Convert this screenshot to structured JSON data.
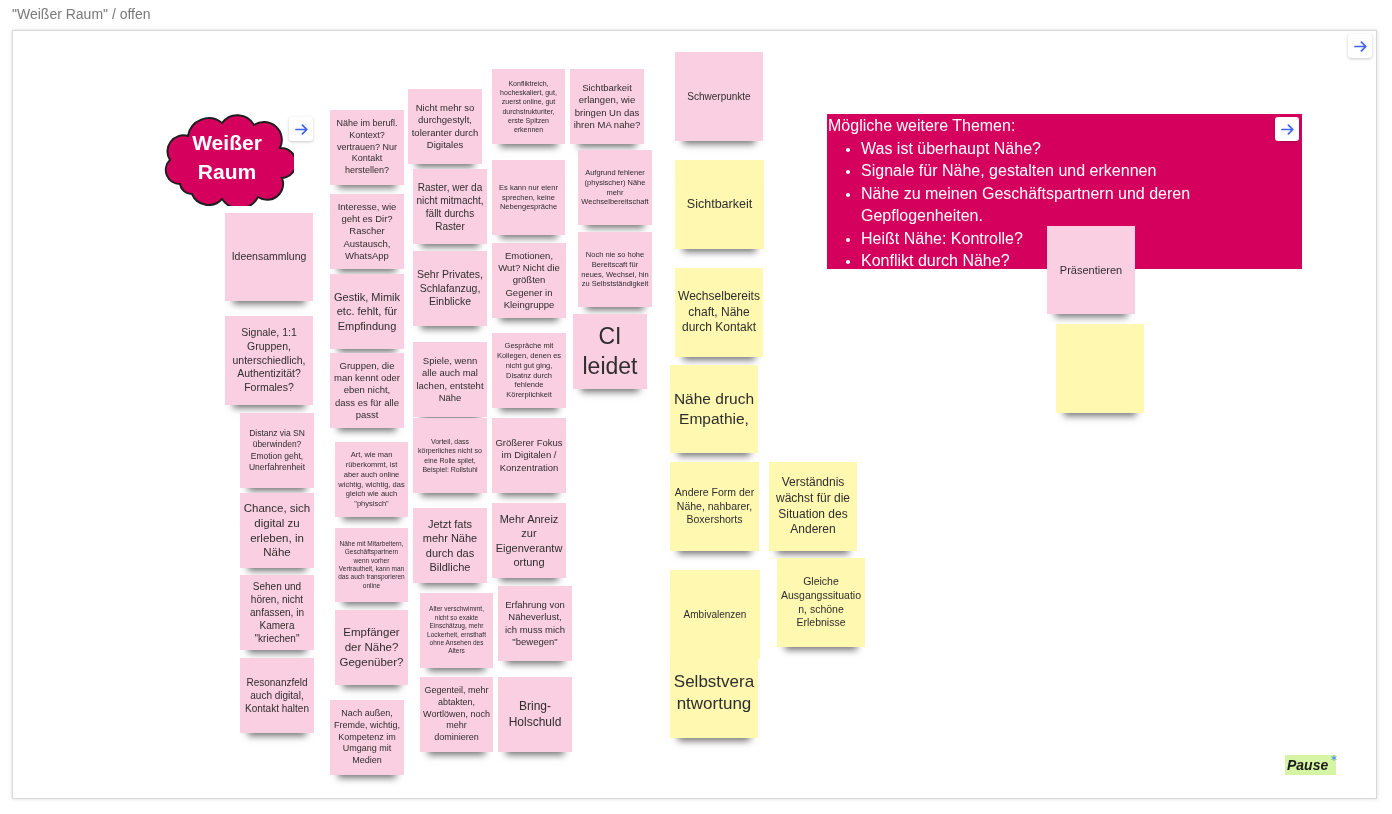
{
  "board": {
    "title": "\"Weißer Raum\" / offen"
  },
  "cloud": {
    "text": "Weißer Raum"
  },
  "notes": [
    {
      "text": "Ideensammlung",
      "color": "#fbcfe2"
    },
    {
      "text": "Signale, 1:1 Gruppen, unterschiedlich, Authentizität? Formales?",
      "color": "#fbcfe2"
    },
    {
      "text": "Distanz via SN überwinden? Emotion geht, Unerfahrenheit",
      "color": "#fbcfe2"
    },
    {
      "text": "Chance, sich digital zu erleben, in Nähe",
      "color": "#fbcfe2"
    },
    {
      "text": "Sehen und hören, nicht anfassen, in Kamera \"kriechen\"",
      "color": "#fbcfe2"
    },
    {
      "text": "Resonanzfeld auch digital, Kontakt halten",
      "color": "#fbcfe2"
    },
    {
      "text": "Nähe im berufl. Kontext? vertrauen? Nur Kontakt herstellen?",
      "color": "#fbcfe2"
    },
    {
      "text": "Interesse, wie geht es Dir? Rascher Austausch, WhatsApp",
      "color": "#fbcfe2"
    },
    {
      "text": "Gestik, Mimik etc. fehlt, für Empfindung",
      "color": "#fbcfe2"
    },
    {
      "text": "Gruppen, die man kennt oder eben nicht, dass es für alle passt",
      "color": "#fbcfe2"
    },
    {
      "text": "Art, wie man rüberkommt, ist aber auch online wichtig, wichtig, das gleich wie auch \"physisch\"",
      "color": "#fbcfe2"
    },
    {
      "text": "Nähe mit Mitarbeitern, Geschäftspartnern wenn vorher Vertrautheit, kann man das auch transporieren online",
      "color": "#fbcfe2"
    },
    {
      "text": "Empfänger der Nähe? Gegenüber?",
      "color": "#fbcfe2"
    },
    {
      "text": "Nach außen, Fremde, wichtig, Kompetenz im Umgang mit Medien",
      "color": "#fbcfe2"
    },
    {
      "text": "Nicht mehr so durchgestylt, toleranter durch Digitales",
      "color": "#fbcfe2"
    },
    {
      "text": "Raster, wer da nicht mitmacht, fällt durchs Raster",
      "color": "#fbcfe2"
    },
    {
      "text": "Sehr Privates, Schlafanzug, Einblicke",
      "color": "#fbcfe2"
    },
    {
      "text": "Spiele, wenn alle auch mal lachen, entsteht Nähe",
      "color": "#fbcfe2"
    },
    {
      "text": "Vorteil, dass körperliches nicht so eine Rolle spilet, Beispiel: Rollstuhl",
      "color": "#fbcfe2"
    },
    {
      "text": "Jetzt fats mehr Nähe durch das Bildliche",
      "color": "#fbcfe2"
    },
    {
      "text": "Alter verschwimmt, nicht so exakte Einschätzug, mehr Lockerheit, ernsthaft ohne Ansehen des Alters",
      "color": "#fbcfe2"
    },
    {
      "text": "Gegenteil, mehr abtakten, Wortlöwen, noch mehr dominieren",
      "color": "#fbcfe2"
    },
    {
      "text": "Konfliktreich, hocheskaliert, gut, zuerst online, gut durchstrukturiter, erste Spitzen erkennen",
      "color": "#fbcfe2"
    },
    {
      "text": "Es kann nur eienr sprechen, keine Nebengespräche",
      "color": "#fbcfe2"
    },
    {
      "text": "Emotionen, Wut? Nicht die größten Gegener in Kleingruppe",
      "color": "#fbcfe2"
    },
    {
      "text": "Gespräche mit Kollegen, denen es nicht gut ging, Disatnz durch fehlende Körerplichkeit",
      "color": "#fbcfe2"
    },
    {
      "text": "Größerer Fokus im Digitalen / Konzentration",
      "color": "#fbcfe2"
    },
    {
      "text": "Mehr Anreiz zur Eigenverantwortung",
      "color": "#fbcfe2"
    },
    {
      "text": "Erfahrung von Näheverlust, ich muss mich \"bewegen\"",
      "color": "#fbcfe2"
    },
    {
      "text": "Bring-Holschuld",
      "color": "#fbcfe2"
    },
    {
      "text": "Sichtbarkeit erlangen, wie bringen Un das ihren MA nahe?",
      "color": "#fbcfe2"
    },
    {
      "text": "Aufgrund fehlener (physischer) Nähe mehr Wechselbereitschaft",
      "color": "#fbcfe2"
    },
    {
      "text": "Noch nie so hohe Bereitscaft für neues, Wechsel, hin zu Selbstständigkeit",
      "color": "#fbcfe2"
    },
    {
      "text": "CI leidet",
      "color": "#fbcfe2"
    },
    {
      "text": "Schwerpunkte",
      "color": "#fbcfe2"
    },
    {
      "text": "Sichtbarkeit",
      "color": "#fef8b0"
    },
    {
      "text": "Wechselbereitschaft, Nähe durch Kontakt",
      "color": "#fef8b0"
    },
    {
      "text": "Nähe druch Empathie,",
      "color": "#fef8b0"
    },
    {
      "text": "Andere Form der Nähe, nahbarer, Boxershorts",
      "color": "#fef8b0"
    },
    {
      "text": "Verständnis wächst für die Situation des Anderen",
      "color": "#fef8b0"
    },
    {
      "text": "Ambivalenzen",
      "color": "#fef8b0"
    },
    {
      "text": "Gleiche Ausgangssituation, schöne Erlebnisse",
      "color": "#fef8b0"
    },
    {
      "text": "Selbstverantwortung",
      "color": "#fef8b0"
    },
    {
      "text": "Präsentieren",
      "color": "#fbcfe2"
    },
    {
      "color": "#fef8b0"
    }
  ],
  "topics_panel": {
    "title": "Mögliche weitere Themen:",
    "items": [
      "Was ist überhaupt Nähe?",
      "Signale für Nähe, gestalten und erkennen",
      "Nähe zu meinen Geschäftspartnern und deren Gepflogenheiten.",
      "Heißt Nähe: Kontrolle?",
      "Konflikt durch Nähe?"
    ]
  },
  "pause_label": "Pause"
}
